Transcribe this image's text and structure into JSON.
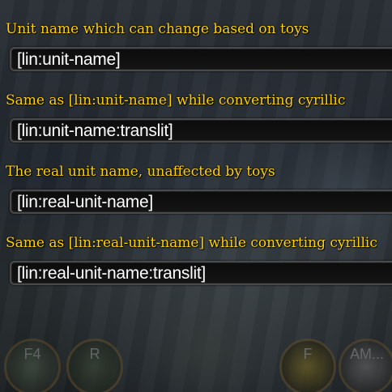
{
  "fields": [
    {
      "description": "Unit name which can change based on toys",
      "value": "[lin:unit-name]"
    },
    {
      "description": "Same as [lin:unit-name] while converting cyrillic",
      "value": "[lin:unit-name:translit]"
    },
    {
      "description": "The real unit name, unaffected by toys",
      "value": "[lin:real-unit-name]"
    },
    {
      "description": "Same as [lin:real-unit-name] while converting cyrillic",
      "value": "[lin:real-unit-name:translit]"
    }
  ],
  "action_bar": {
    "keys": [
      "F4",
      "R",
      "F",
      "AM..."
    ]
  }
}
